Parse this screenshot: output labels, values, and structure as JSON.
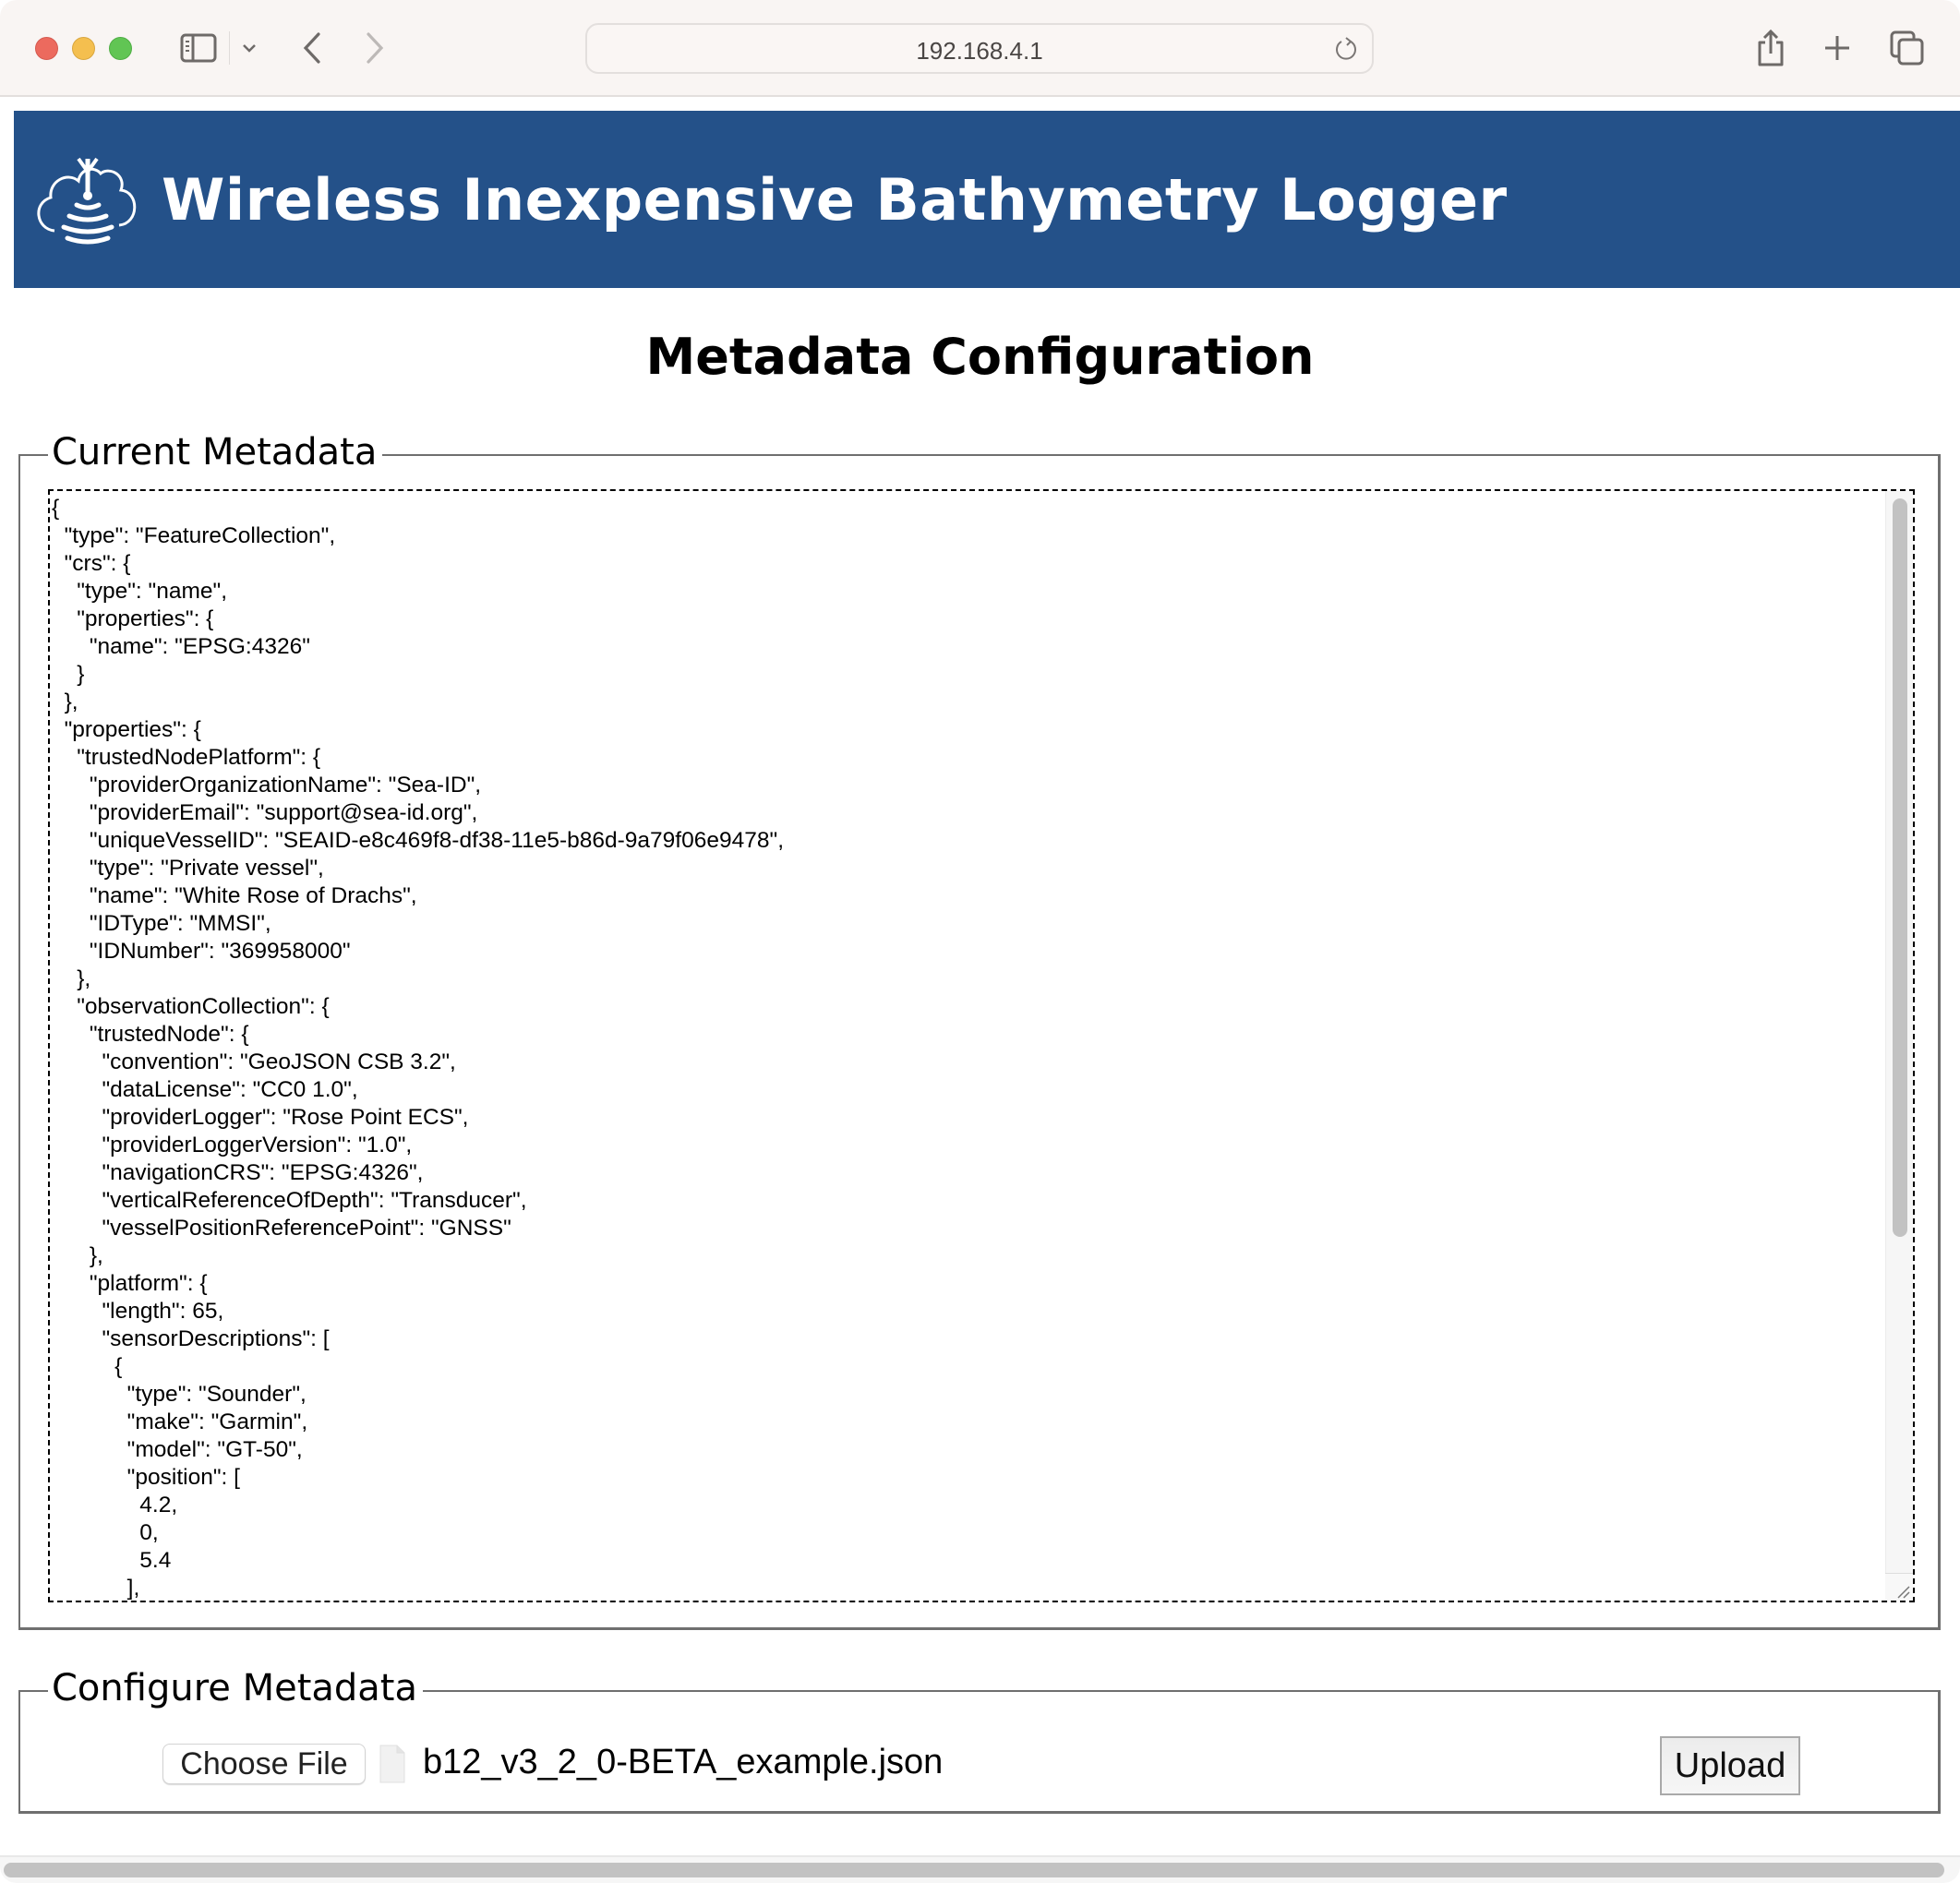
{
  "browser": {
    "url": "192.168.4.1",
    "icons": {
      "close": "close-window",
      "minimize": "minimize-window",
      "zoom": "zoom-window",
      "sidebar": "sidebar-icon",
      "sidebar_menu": "chevron-down-icon",
      "back": "chevron-left-icon",
      "forward": "chevron-right-icon",
      "reload": "reload-icon",
      "share": "share-icon",
      "new_tab": "plus-icon",
      "tab_overview": "tabs-icon"
    }
  },
  "banner": {
    "title": "Wireless Inexpensive Bathymetry Logger",
    "logo": "cloud-antenna-signal-logo",
    "background_color": "#245189"
  },
  "page": {
    "title": "Metadata Configuration"
  },
  "current_metadata": {
    "legend": "Current Metadata",
    "json_text": "{\n  \"type\": \"FeatureCollection\",\n  \"crs\": {\n    \"type\": \"name\",\n    \"properties\": {\n      \"name\": \"EPSG:4326\"\n    }\n  },\n  \"properties\": {\n    \"trustedNodePlatform\": {\n      \"providerOrganizationName\": \"Sea-ID\",\n      \"providerEmail\": \"support@sea-id.org\",\n      \"uniqueVesselID\": \"SEAID-e8c469f8-df38-11e5-b86d-9a79f06e9478\",\n      \"type\": \"Private vessel\",\n      \"name\": \"White Rose of Drachs\",\n      \"IDType\": \"MMSI\",\n      \"IDNumber\": \"369958000\"\n    },\n    \"observationCollection\": {\n      \"trustedNode\": {\n        \"convention\": \"GeoJSON CSB 3.2\",\n        \"dataLicense\": \"CC0 1.0\",\n        \"providerLogger\": \"Rose Point ECS\",\n        \"providerLoggerVersion\": \"1.0\",\n        \"navigationCRS\": \"EPSG:4326\",\n        \"verticalReferenceOfDepth\": \"Transducer\",\n        \"vesselPositionReferencePoint\": \"GNSS\"\n      },\n      \"platform\": {\n        \"length\": 65,\n        \"sensorDescriptions\": [\n          {\n            \"type\": \"Sounder\",\n            \"make\": \"Garmin\",\n            \"model\": \"GT-50\",\n            \"position\": [\n              4.2,\n              0,\n              5.4\n            ],"
  },
  "configure_metadata": {
    "legend": "Configure Metadata",
    "choose_file_label": "Choose File",
    "selected_file": "b12_v3_2_0-BETA_example.json",
    "upload_label": "Upload"
  }
}
